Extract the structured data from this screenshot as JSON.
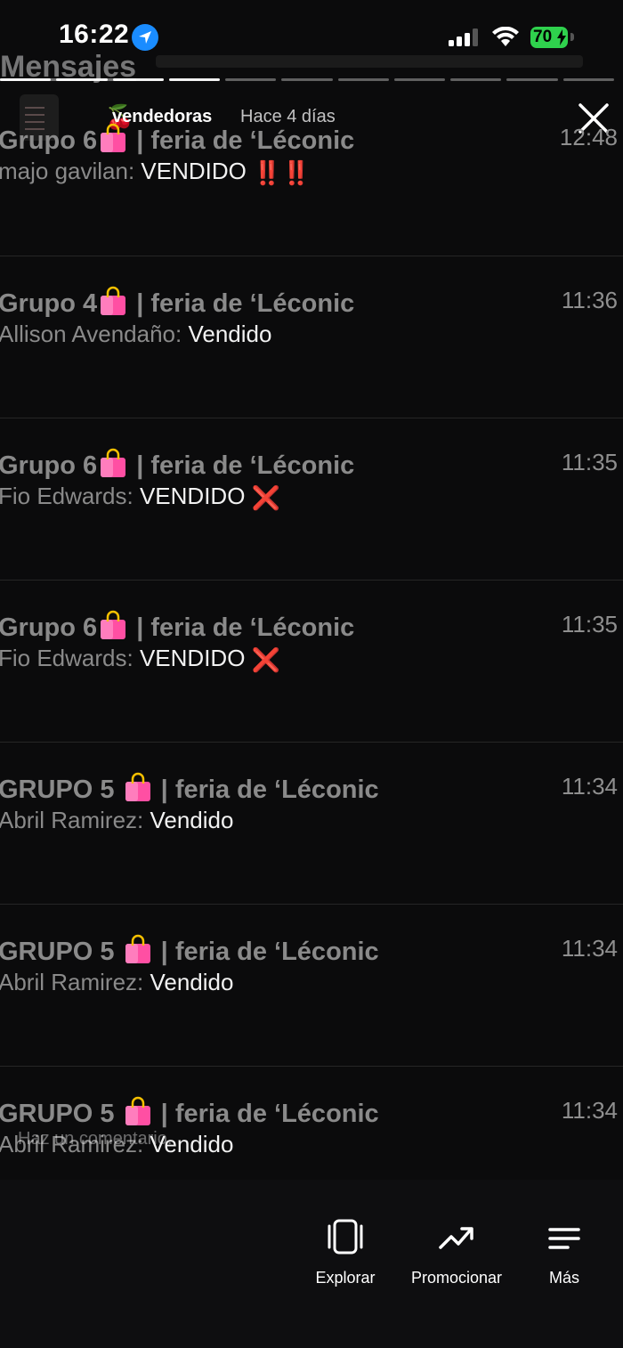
{
  "status_bar": {
    "time": "16:22",
    "battery": "70"
  },
  "background": {
    "title": "Mensajes"
  },
  "story": {
    "account": "vendedoras",
    "ago": "Hace 4 días",
    "segments_total": 11,
    "segments_done": 4
  },
  "chats": [
    {
      "title": "Grupo 6",
      "title_suffix": " | feria de ‘Léconic",
      "time": "12:48",
      "sender": "majo gavilan:",
      "message": " VENDIDO ",
      "mark": "‼️‼️",
      "mark_type": "double-exclaim"
    },
    {
      "title": "Grupo 4",
      "title_suffix": " | feria de ‘Léconic",
      "time": "11:36",
      "sender": "Allison Avendaño:",
      "message": " Vendido",
      "mark": "",
      "mark_type": ""
    },
    {
      "title": "Grupo 6",
      "title_suffix": " | feria de ‘Léconic",
      "time": "11:35",
      "sender": "Fio Edwards:",
      "message": " VENDIDO ",
      "mark": "❌",
      "mark_type": "cross"
    },
    {
      "title": "Grupo 6",
      "title_suffix": " | feria de ‘Léconic",
      "time": "11:35",
      "sender": "Fio Edwards:",
      "message": " VENDIDO ",
      "mark": "❌",
      "mark_type": "cross"
    },
    {
      "title": "GRUPO 5 ",
      "title_suffix": " | feria de ‘Léconic",
      "time": "11:34",
      "sender": "Abril Ramirez:",
      "message": " Vendido",
      "mark": "",
      "mark_type": ""
    },
    {
      "title": "GRUPO 5 ",
      "title_suffix": " | feria de ‘Léconic",
      "time": "11:34",
      "sender": "Abril Ramirez:",
      "message": " Vendido",
      "mark": "",
      "mark_type": ""
    },
    {
      "title": "GRUPO 5 ",
      "title_suffix": " | feria de ‘Léconic",
      "time": "11:34",
      "sender": "Abril Ramirez:",
      "message": " Vendido",
      "mark": "",
      "mark_type": ""
    }
  ],
  "comment_placeholder": "Haz un comentario...",
  "bottom_nav": {
    "explore": "Explorar",
    "promote": "Promocionar",
    "more": "Más"
  },
  "colors": {
    "battery": "#2fd14d",
    "location": "#1a8cff",
    "bag": "#ff4fa3",
    "red_mark": "#e02020"
  }
}
